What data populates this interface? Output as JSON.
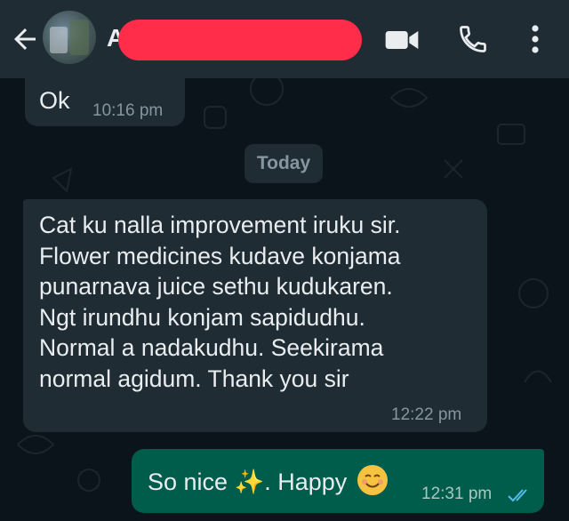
{
  "header": {
    "contact_initial": "A",
    "icons": [
      "arrow-left-icon",
      "video-camera-icon",
      "phone-icon",
      "more-vertical-icon"
    ]
  },
  "messages": [
    {
      "direction": "incoming",
      "text": "Ok",
      "time": "10:16 pm"
    },
    {
      "direction": "incoming",
      "text": "Cat ku nalla improvement iruku sir.\nFlower medicines kudave konjama\npunarnava juice sethu kudukaren.\nNgt irundhu konjam sapidudhu.\nNormal a nadakudhu. Seekirama\nnormal agidum. Thank you sir",
      "time": "12:22 pm"
    },
    {
      "direction": "outgoing",
      "text_before": "So nice",
      "sparkle": "✨",
      "text_after": ". Happy",
      "time": "12:31 pm",
      "status": "read"
    }
  ],
  "date_divider": "Today",
  "colors": {
    "header_bg": "#1f2c34",
    "chat_bg": "#0b141a",
    "incoming_bubble": "#1f2c34",
    "outgoing_bubble": "#005c4b",
    "read_ticks": "#53bdeb",
    "redaction": "#ff2d4a"
  }
}
